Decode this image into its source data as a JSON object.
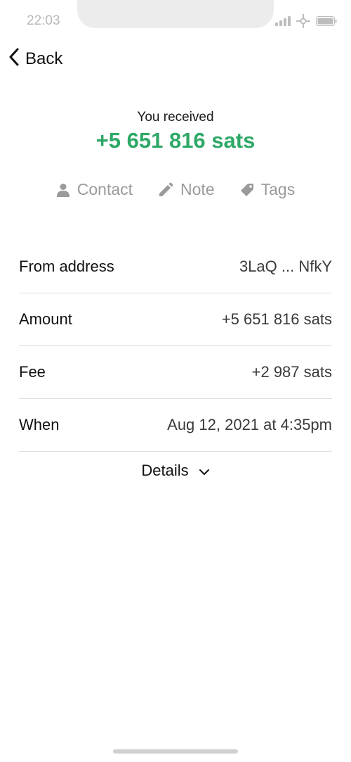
{
  "status_bar": {
    "time": "22:03",
    "icons": [
      "signal-icon",
      "network-icon",
      "battery-icon"
    ]
  },
  "nav": {
    "back_label": "Back",
    "back_icon": "chevron-left-icon"
  },
  "summary": {
    "label": "You received",
    "amount": "+5 651 816 sats",
    "amount_color": "#2ea867"
  },
  "actions": [
    {
      "label": "Contact",
      "icon": "person-icon"
    },
    {
      "label": "Note",
      "icon": "pencil-icon"
    },
    {
      "label": "Tags",
      "icon": "tag-icon"
    }
  ],
  "details": [
    {
      "label": "From address",
      "value": "3LaQ ... NfkY"
    },
    {
      "label": "Amount",
      "value": "+5 651 816 sats"
    },
    {
      "label": "Fee",
      "value": "+2 987 sats"
    },
    {
      "label": "When",
      "value": "Aug 12, 2021 at 4:35pm"
    }
  ],
  "details_toggle": {
    "label": "Details",
    "icon": "chevron-down-icon"
  }
}
